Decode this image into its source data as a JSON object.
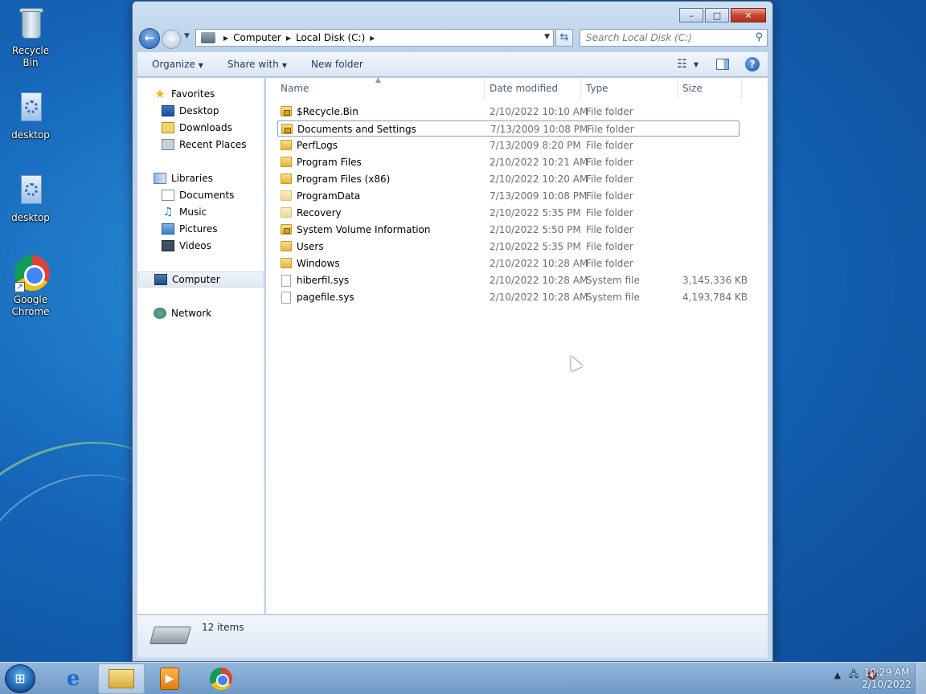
{
  "desktop": {
    "icons": [
      {
        "label": "Recycle Bin",
        "icon": "recycle-bin-icon"
      },
      {
        "label": "desktop",
        "icon": "config-file-icon"
      },
      {
        "label": "desktop",
        "icon": "config-file-icon"
      },
      {
        "label": "Google Chrome",
        "icon": "chrome-icon"
      }
    ]
  },
  "window": {
    "caption_buttons": {
      "minimize": "–",
      "maximize": "□",
      "close": "✕"
    },
    "address": {
      "crumbs": [
        "Computer",
        "Local Disk (C:)"
      ]
    },
    "search_placeholder": "Search Local Disk (C:)",
    "toolbar": {
      "organize": "Organize",
      "share_with": "Share with",
      "new_folder": "New folder"
    },
    "nav_pane": {
      "favorites": "Favorites",
      "desktop": "Desktop",
      "downloads": "Downloads",
      "recent_places": "Recent Places",
      "libraries": "Libraries",
      "documents": "Documents",
      "music": "Music",
      "pictures": "Pictures",
      "videos": "Videos",
      "computer": "Computer",
      "network": "Network"
    },
    "columns": {
      "name": "Name",
      "date": "Date modified",
      "type": "Type",
      "size": "Size"
    },
    "files": [
      {
        "name": "$Recycle.Bin",
        "date": "2/10/2022 10:10 AM",
        "type": "File folder",
        "size": "",
        "icon": "locked-folder-icon"
      },
      {
        "name": "Documents and Settings",
        "date": "7/13/2009 10:08 PM",
        "type": "File folder",
        "size": "",
        "icon": "locked-folder-icon"
      },
      {
        "name": "PerfLogs",
        "date": "7/13/2009 8:20 PM",
        "type": "File folder",
        "size": "",
        "icon": "folder-icon"
      },
      {
        "name": "Program Files",
        "date": "2/10/2022 10:21 AM",
        "type": "File folder",
        "size": "",
        "icon": "folder-icon"
      },
      {
        "name": "Program Files (x86)",
        "date": "2/10/2022 10:20 AM",
        "type": "File folder",
        "size": "",
        "icon": "folder-icon"
      },
      {
        "name": "ProgramData",
        "date": "7/13/2009 10:08 PM",
        "type": "File folder",
        "size": "",
        "icon": "hidden-folder-icon"
      },
      {
        "name": "Recovery",
        "date": "2/10/2022 5:35 PM",
        "type": "File folder",
        "size": "",
        "icon": "hidden-folder-icon"
      },
      {
        "name": "System Volume Information",
        "date": "2/10/2022 5:50 PM",
        "type": "File folder",
        "size": "",
        "icon": "locked-folder-icon"
      },
      {
        "name": "Users",
        "date": "2/10/2022 5:35 PM",
        "type": "File folder",
        "size": "",
        "icon": "folder-icon"
      },
      {
        "name": "Windows",
        "date": "2/10/2022 10:28 AM",
        "type": "File folder",
        "size": "",
        "icon": "folder-icon"
      },
      {
        "name": "hiberfil.sys",
        "date": "2/10/2022 10:28 AM",
        "type": "System file",
        "size": "3,145,336 KB",
        "icon": "system-file-icon"
      },
      {
        "name": "pagefile.sys",
        "date": "2/10/2022 10:28 AM",
        "type": "System file",
        "size": "4,193,784 KB",
        "icon": "system-file-icon"
      }
    ],
    "status": {
      "item_count": "12 items"
    }
  },
  "taskbar": {
    "items": [
      "internet-explorer-icon",
      "windows-explorer-icon",
      "media-player-icon",
      "chrome-icon"
    ],
    "clock": {
      "time": "10:29 AM",
      "date": "2/10/2022"
    }
  }
}
